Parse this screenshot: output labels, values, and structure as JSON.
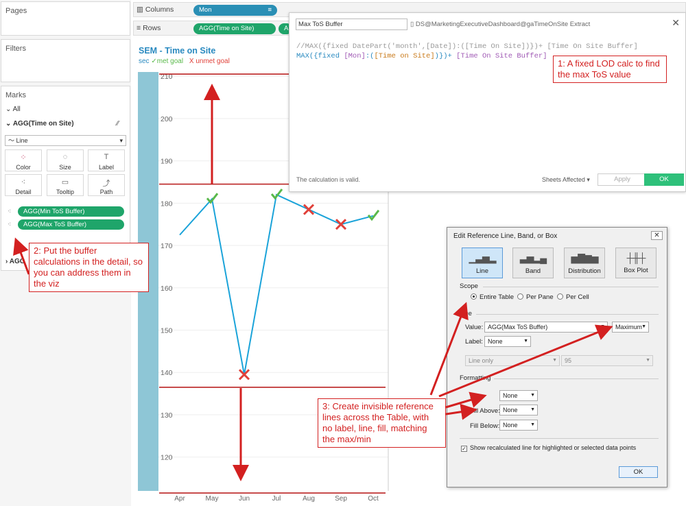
{
  "left": {
    "pages": "Pages",
    "filters": "Filters",
    "marks": "Marks",
    "all": "All",
    "agg_header": "AGG(Time on Site)",
    "mark_type": "Line",
    "buttons": [
      "Color",
      "Size",
      "Label",
      "Detail",
      "Tooltip",
      "Path"
    ],
    "pills": [
      "AGG(Min ToS Buffer)",
      "AGG(Max ToS Buffer)"
    ],
    "agg_second": "AGG"
  },
  "shelves": {
    "columns_label": "Columns",
    "rows_label": "Rows",
    "columns_pill": "Mon",
    "rows_pill": "AGG(Time on Site)",
    "rows_pill2": "A"
  },
  "viz": {
    "title": "SEM - Time on Site",
    "legend_sec": "sec",
    "legend_met": "met goal",
    "legend_unmet": "unmet goal"
  },
  "calc": {
    "name": "Max ToS Buffer",
    "datasource": "DS@MarketingExecutiveDashboard@gaTimeOnSite Extract",
    "line1": "//MAX({fixed DatePart('month',[Date]):([Time On Site])})+ [Time On Site Buffer]",
    "line2_a": "MAX({fixed ",
    "line2_b": "[Mon]",
    "line2_c": ":(",
    "line2_d": "[Time on Site]",
    "line2_e": ")})+ ",
    "line2_f": "[Time On Site Buffer]",
    "valid": "The calculation is valid.",
    "sheets_affected": "Sheets Affected",
    "apply": "Apply",
    "ok": "OK"
  },
  "annotations": {
    "a1": "1: A fixed LOD calc to find the max ToS value",
    "a2": "2: Put the buffer calculations in the detail, so you can address them in the viz",
    "a3": "3: Create invisible reference lines across the Table, with no label, line, fill, matching the max/min"
  },
  "refdlg": {
    "title": "Edit Reference Line, Band, or Box",
    "types": [
      "Line",
      "Band",
      "Distribution",
      "Box Plot"
    ],
    "scope": "Scope",
    "scope_opts": [
      "Entire Table",
      "Per Pane",
      "Per Cell"
    ],
    "line_section": "Line",
    "value_label": "Value:",
    "value": "AGG(Max ToS Buffer)",
    "agg": "Maximum",
    "label_label": "Label:",
    "label_value": "None",
    "line_only": "Line only",
    "ninety_five": "95",
    "formatting": "Formatting",
    "line_fmt_label": "Line:",
    "line_fmt": "None",
    "fill_above_label": "Fill Above:",
    "fill_above": "None",
    "fill_below_label": "Fill Below:",
    "fill_below": "None",
    "show_recalc": "Show recalculated line for highlighted or selected data points",
    "ok": "OK"
  },
  "chart_data": {
    "type": "line",
    "categories": [
      "Apr",
      "May",
      "Jun",
      "Jul",
      "Aug",
      "Sep",
      "Oct"
    ],
    "values": [
      172.5,
      181,
      139.5,
      182,
      178.5,
      175,
      177
    ],
    "status": [
      "none",
      "met",
      "unmet",
      "met",
      "unmet",
      "unmet",
      "met"
    ],
    "ylim": [
      112,
      211
    ],
    "yticks": [
      120,
      130,
      140,
      150,
      160,
      170,
      180,
      190,
      200,
      210
    ],
    "reference_lines": [
      210.5,
      184.5,
      136.5,
      111.5
    ],
    "colors": {
      "line": "#1aa3d9",
      "met": "#59b94a",
      "unmet": "#e0413a",
      "band": "#8ec6d6"
    }
  }
}
